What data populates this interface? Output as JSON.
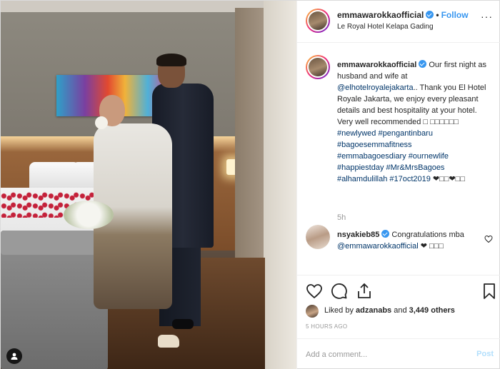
{
  "post": {
    "username": "emmawarokkaofficial",
    "follow_label": "Follow",
    "dot": "•",
    "location": "Le Royal Hotel Kelapa Gading",
    "more_label": "···"
  },
  "caption": {
    "username": "emmawarokkaofficial",
    "text_1": " Our first night as husband and wife at ",
    "mention": "@elhotelroyalejakarta",
    "text_2": ".. Thank you El Hotel Royale Jakarta, we enjoy every pleasant details and best hospitality at your hotel. Very well recommended ",
    "emoji_run": "□ □□□□□□",
    "hashtags": [
      "#newlywed",
      "#pengantinbaru",
      "#bagoesemmafitness",
      "#emmabagoesdiary",
      "#ournewlife",
      "#happiestday",
      "#Mr&MrsBagoes",
      "#alhamdulillah",
      "#17oct2019"
    ],
    "tail": " ❤□□❤□□",
    "time": "5h"
  },
  "comment": {
    "username": "nsyakieb85",
    "text_1": " Congratulations mba ",
    "mention": "@emmawarokkaofficial",
    "text_2": " ❤ □□□"
  },
  "likes": {
    "prefix": "Liked by ",
    "user": "adzanabs",
    "middle": " and ",
    "count": "3,449 others"
  },
  "timestamp": "5 HOURS AGO",
  "add_comment": {
    "placeholder": "Add a comment...",
    "post_label": "Post"
  },
  "colors": {
    "link_blue": "#3897f0",
    "mention_blue": "#003569",
    "muted": "#999999",
    "text": "#262626"
  },
  "icons": [
    "heart-icon",
    "comment-icon",
    "share-icon",
    "bookmark-icon",
    "verified-icon",
    "more-icon",
    "user-tag-icon"
  ]
}
